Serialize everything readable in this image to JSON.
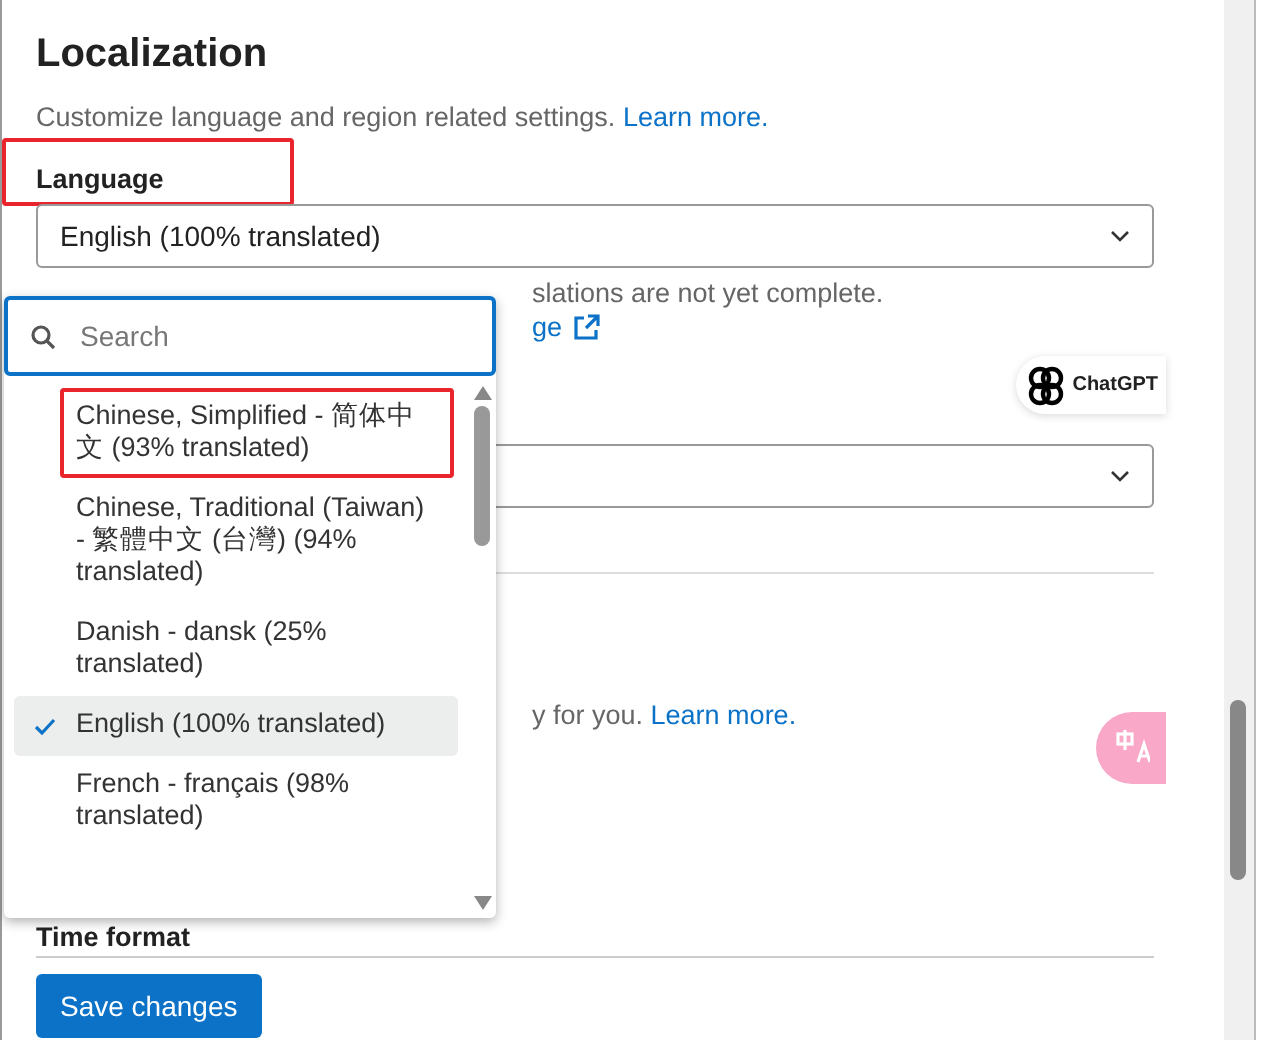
{
  "heading": "Localization",
  "description": {
    "text": "Customize language and region related settings.",
    "link": "Learn more."
  },
  "language": {
    "label": "Language",
    "annotated": true,
    "value": "English (100% translated)",
    "help_fragment": "slations are not yet complete.",
    "link_fragment": "ge"
  },
  "section_fragment": {
    "text": "y for you.",
    "link": "Learn more."
  },
  "time_format": {
    "label": "Time format"
  },
  "dropdown": {
    "search_placeholder": "Search",
    "options": [
      {
        "label": "Chinese, Simplified - 简体中文 (93% translated)",
        "selected": false,
        "annotated": true
      },
      {
        "label": "Chinese, Traditional (Taiwan) - 繁體中文 (台灣) (94% translated)",
        "selected": false,
        "annotated": false
      },
      {
        "label": "Danish - dansk (25% translated)",
        "selected": false,
        "annotated": false
      },
      {
        "label": "English (100% translated)",
        "selected": true,
        "annotated": false
      },
      {
        "label": "French - français (98% translated)",
        "selected": false,
        "annotated": false
      }
    ]
  },
  "save_button": "Save changes",
  "overlays": {
    "chatgpt_label": "ChatGPT"
  }
}
